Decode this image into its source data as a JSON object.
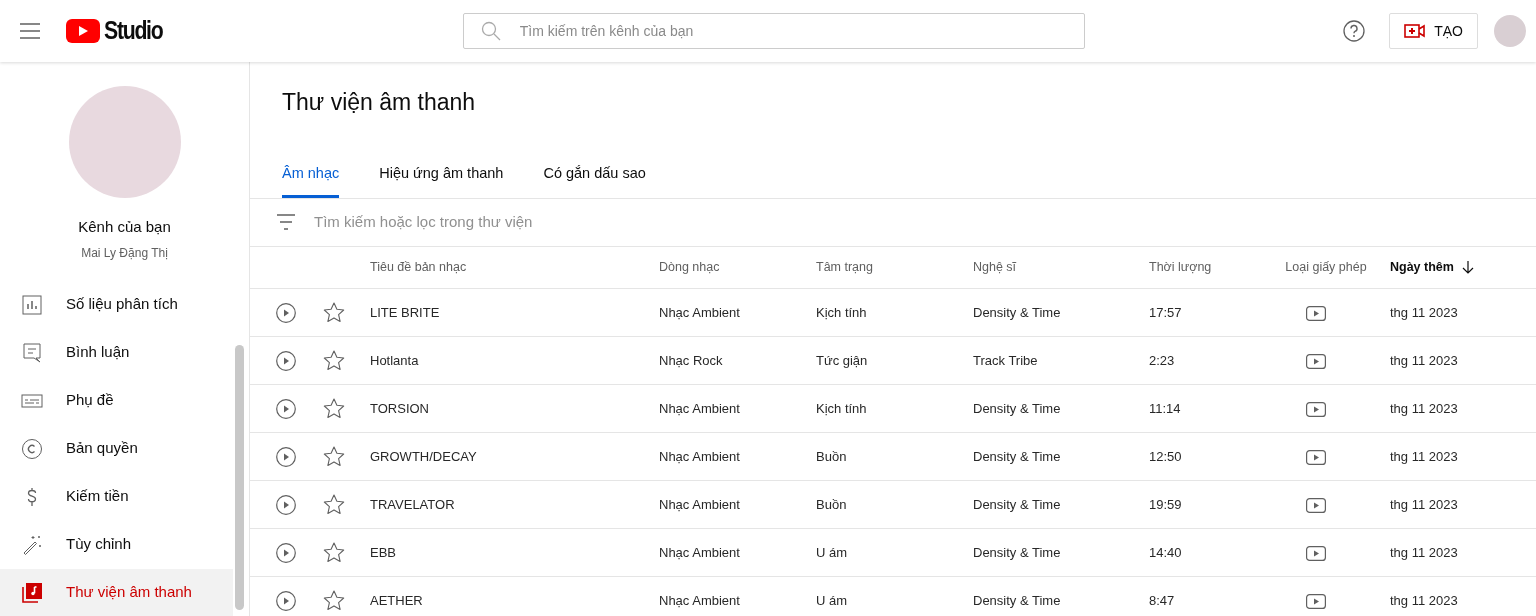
{
  "header": {
    "logo_text": "Studio",
    "search": {
      "placeholder": "Tìm kiếm trên kênh của bạn"
    },
    "create_button": "TẠO"
  },
  "sidebar": {
    "channel_title": "Kênh của bạn",
    "channel_name": "Mai Ly Đặng Thị",
    "items": [
      {
        "kind": "analytics",
        "label": "Số liệu phân tích",
        "selected": false
      },
      {
        "kind": "comments",
        "label": "Bình luận",
        "selected": false
      },
      {
        "kind": "subtitles",
        "label": "Phụ đề",
        "selected": false
      },
      {
        "kind": "copyright",
        "label": "Bản quyền",
        "selected": false
      },
      {
        "kind": "monetization",
        "label": "Kiếm tiền",
        "selected": false
      },
      {
        "kind": "customization",
        "label": "Tùy chỉnh",
        "selected": false
      },
      {
        "kind": "audio_library",
        "label": "Thư viện âm thanh",
        "selected": true
      }
    ]
  },
  "page_title": "Thư viện âm thanh",
  "tabs": [
    {
      "label": "Âm nhạc",
      "selected": true
    },
    {
      "label": "Hiệu ứng âm thanh",
      "selected": false
    },
    {
      "label": "Có gắn dấu sao",
      "selected": false
    }
  ],
  "filter": {
    "placeholder": "Tìm kiếm hoặc lọc trong thư viện"
  },
  "table": {
    "columns": [
      {
        "label": "Tiêu đề bản nhạc",
        "sorted": false
      },
      {
        "label": "Dòng nhạc",
        "sorted": false
      },
      {
        "label": "Tâm trạng",
        "sorted": false
      },
      {
        "label": "Nghệ sĩ",
        "sorted": false
      },
      {
        "label": "Thời lượng",
        "sorted": false
      },
      {
        "label": "Loại giấy phép",
        "sorted": false
      },
      {
        "label": "Ngày thêm",
        "sorted": true
      }
    ],
    "rows": [
      {
        "starred": false,
        "title": "LITE BRITE",
        "genre": "Nhạc Ambient",
        "mood": "Kịch tính",
        "artist": "Density & Time",
        "duration": "17:57",
        "added": "thg 11 2023"
      },
      {
        "starred": false,
        "title": "Hotlanta",
        "genre": "Nhạc Rock",
        "mood": "Tức giận",
        "artist": "Track Tribe",
        "duration": "2:23",
        "added": "thg 11 2023"
      },
      {
        "starred": false,
        "title": "TORSION",
        "genre": "Nhạc Ambient",
        "mood": "Kịch tính",
        "artist": "Density & Time",
        "duration": "11:14",
        "added": "thg 11 2023"
      },
      {
        "starred": false,
        "title": "GROWTH/DECAY",
        "genre": "Nhạc Ambient",
        "mood": "Buồn",
        "artist": "Density & Time",
        "duration": "12:50",
        "added": "thg 11 2023"
      },
      {
        "starred": false,
        "title": "TRAVELATOR",
        "genre": "Nhạc Ambient",
        "mood": "Buồn",
        "artist": "Density & Time",
        "duration": "19:59",
        "added": "thg 11 2023"
      },
      {
        "starred": false,
        "title": "EBB",
        "genre": "Nhạc Ambient",
        "mood": "U ám",
        "artist": "Density & Time",
        "duration": "14:40",
        "added": "thg 11 2023"
      },
      {
        "starred": false,
        "title": "AETHER",
        "genre": "Nhạc Ambient",
        "mood": "U ám",
        "artist": "Density & Time",
        "duration": "8:47",
        "added": "thg 11 2023"
      }
    ]
  }
}
